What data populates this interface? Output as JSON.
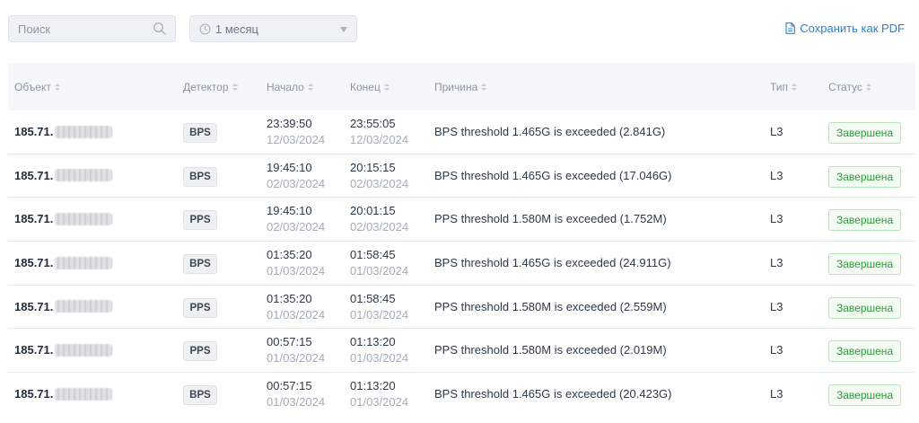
{
  "toolbar": {
    "search_placeholder": "Поиск",
    "period_label": "1 месяц",
    "pdf_label": "Сохранить как PDF"
  },
  "columns": {
    "object": "Объект",
    "detector": "Детектор",
    "start": "Начало",
    "end": "Конец",
    "reason": "Причина",
    "type": "Тип",
    "status": "Статус"
  },
  "rows": [
    {
      "object": "185.71.",
      "detector": "BPS",
      "start_time": "23:39:50",
      "start_date": "12/03/2024",
      "end_time": "23:55:05",
      "end_date": "12/03/2024",
      "reason": "BPS threshold 1.465G is exceeded (2.841G)",
      "type": "L3",
      "status": "Завершена"
    },
    {
      "object": "185.71.",
      "detector": "BPS",
      "start_time": "19:45:10",
      "start_date": "02/03/2024",
      "end_time": "20:15:15",
      "end_date": "02/03/2024",
      "reason": "BPS threshold 1.465G is exceeded (17.046G)",
      "type": "L3",
      "status": "Завершена"
    },
    {
      "object": "185.71.",
      "detector": "PPS",
      "start_time": "19:45:10",
      "start_date": "02/03/2024",
      "end_time": "20:01:15",
      "end_date": "02/03/2024",
      "reason": "PPS threshold 1.580M is exceeded (1.752M)",
      "type": "L3",
      "status": "Завершена"
    },
    {
      "object": "185.71.",
      "detector": "BPS",
      "start_time": "01:35:20",
      "start_date": "01/03/2024",
      "end_time": "01:58:45",
      "end_date": "01/03/2024",
      "reason": "BPS threshold 1.465G is exceeded (24.911G)",
      "type": "L3",
      "status": "Завершена"
    },
    {
      "object": "185.71.",
      "detector": "PPS",
      "start_time": "01:35:20",
      "start_date": "01/03/2024",
      "end_time": "01:58:45",
      "end_date": "01/03/2024",
      "reason": "PPS threshold 1.580M is exceeded (2.559M)",
      "type": "L3",
      "status": "Завершена"
    },
    {
      "object": "185.71.",
      "detector": "PPS",
      "start_time": "00:57:15",
      "start_date": "01/03/2024",
      "end_time": "01:13:20",
      "end_date": "01/03/2024",
      "reason": "PPS threshold 1.580M is exceeded (2.019M)",
      "type": "L3",
      "status": "Завершена"
    },
    {
      "object": "185.71.",
      "detector": "BPS",
      "start_time": "00:57:15",
      "start_date": "01/03/2024",
      "end_time": "01:13:20",
      "end_date": "01/03/2024",
      "reason": "BPS threshold 1.465G is exceeded (20.423G)",
      "type": "L3",
      "status": "Завершена"
    }
  ]
}
